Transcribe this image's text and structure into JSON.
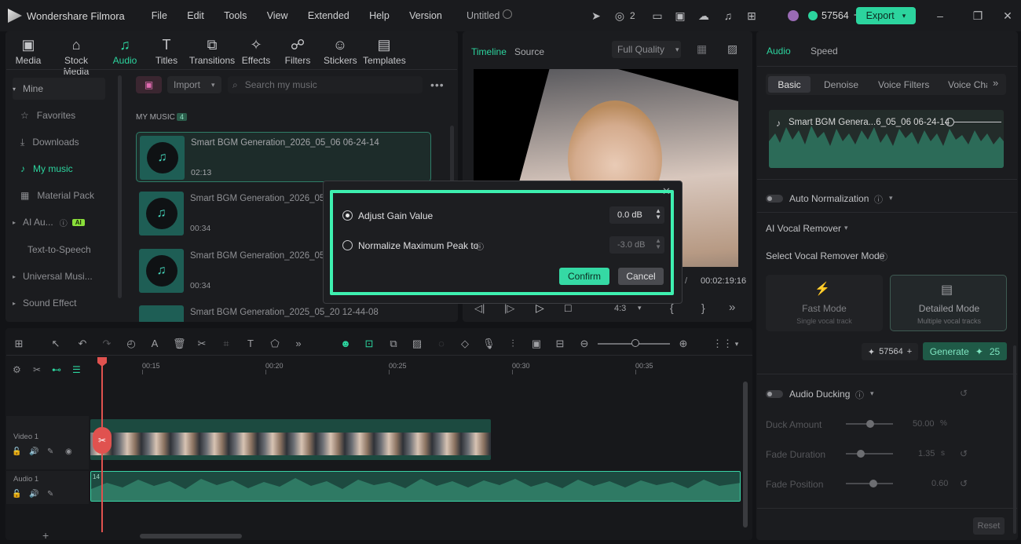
{
  "app": {
    "name": "Wondershare Filmora",
    "project_title": "Untitled",
    "menu": [
      "File",
      "Edit",
      "Tools",
      "View",
      "Extended",
      "Help",
      "Version"
    ],
    "notif_count": "2",
    "credits": "57564",
    "export_label": "Export"
  },
  "library": {
    "tabs": [
      {
        "label": "Media",
        "icon": "media-icon"
      },
      {
        "label": "Stock Media",
        "icon": "stock-media-icon"
      },
      {
        "label": "Audio",
        "icon": "audio-icon"
      },
      {
        "label": "Titles",
        "icon": "titles-icon"
      },
      {
        "label": "Transitions",
        "icon": "transitions-icon"
      },
      {
        "label": "Effects",
        "icon": "effects-icon"
      },
      {
        "label": "Filters",
        "icon": "filters-icon"
      },
      {
        "label": "Stickers",
        "icon": "stickers-icon"
      },
      {
        "label": "Templates",
        "icon": "templates-icon"
      }
    ],
    "sidebar": [
      {
        "label": "Mine"
      },
      {
        "label": "Favorites"
      },
      {
        "label": "Downloads"
      },
      {
        "label": "My music"
      },
      {
        "label": "Material Pack"
      },
      {
        "label": "AI Au...",
        "badge": "AI"
      },
      {
        "label": "Text-to-Speech"
      },
      {
        "label": "Universal Musi..."
      },
      {
        "label": "Sound Effect"
      }
    ],
    "import_label": "Import",
    "search_placeholder": "Search my music",
    "section_title": "MY MUSIC",
    "section_count": "4",
    "items": [
      {
        "title": "Smart BGM Generation_2026_05_06 06-24-14",
        "duration": "02:13"
      },
      {
        "title": "Smart BGM Generation_2026_05_06",
        "duration": "00:34"
      },
      {
        "title": "Smart BGM Generation_2026_05_06",
        "duration": "00:34"
      },
      {
        "title": "Smart BGM Generation_2025_05_20 12-44-08",
        "duration": ""
      }
    ]
  },
  "preview": {
    "tab_timeline": "Timeline",
    "tab_source": "Source",
    "quality": "Full Quality",
    "total_time": "00:02:19:16",
    "aspect": "4:3"
  },
  "inspector": {
    "tabs": [
      "Audio",
      "Speed"
    ],
    "subtabs": [
      "Basic",
      "Denoise",
      "Voice Filters",
      "Voice Cha"
    ],
    "clip_name": "Smart BGM Genera...6_05_06 06-24-14",
    "auto_normalization": "Auto Normalization",
    "vocal_remover": "AI Vocal Remover",
    "select_mode": "Select Vocal Remover Mode",
    "modes": [
      {
        "title": "Fast Mode",
        "sub": "Single vocal track"
      },
      {
        "title": "Detailed Mode",
        "sub": "Multiple vocal tracks"
      }
    ],
    "credits": "57564",
    "generate_label": "Generate",
    "generate_cost": "25",
    "ducking": "Audio Ducking",
    "duck_amount": {
      "label": "Duck Amount",
      "value": "50.00",
      "unit": "%"
    },
    "fade_duration": {
      "label": "Fade Duration",
      "value": "1.35",
      "unit": "s"
    },
    "fade_position": {
      "label": "Fade Position",
      "value": "0.60"
    },
    "reset_label": "Reset"
  },
  "timeline": {
    "ruler": [
      "00:15",
      "00:20",
      "00:25",
      "00:30",
      "00:35"
    ],
    "tracks": [
      {
        "label": "Video 1"
      },
      {
        "label": "Audio 1"
      }
    ],
    "audio_clip_label": "14"
  },
  "dialog": {
    "option1": "Adjust Gain Value",
    "value1": "0.0 dB",
    "option2": "Normalize Maximum Peak to",
    "value2": "-3.0 dB",
    "confirm": "Confirm",
    "cancel": "Cancel"
  }
}
